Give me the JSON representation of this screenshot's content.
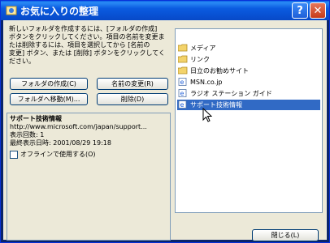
{
  "window": {
    "title": "お気に入りの整理",
    "help_label": "?",
    "close_label": "✕"
  },
  "instructions": [
    "新しいフォルダを作成するには、[フォルダの作成]",
    "ボタンをクリックしてください。項目の名前を変更ま",
    "たは削除するには、項目を選択してから [名前の",
    "変更] ボタン、または [削除] ボタンをクリックしてく",
    "ださい。"
  ],
  "buttons": {
    "create_folder": "フォルダの作成(C)",
    "rename": "名前の変更(R)",
    "move_to_folder": "フォルダへ移動(M)...",
    "delete": "削除(D)",
    "close": "閉じる(L)"
  },
  "details": {
    "name": "サポート技術情報",
    "url": "http://www.microsoft.com/japan/support...",
    "visit_count": "表示回数: 1",
    "last_visited": "最終表示日時: 2001/08/29 19:18",
    "offline_label": "オフラインで使用する(O)",
    "offline_checked": false
  },
  "favorites": [
    {
      "label": "メディア",
      "icon": "folder-icon",
      "selected": false
    },
    {
      "label": "リンク",
      "icon": "folder-icon",
      "selected": false
    },
    {
      "label": "日立のお勧めサイト",
      "icon": "folder-icon",
      "selected": false
    },
    {
      "label": "MSN.co.jp",
      "icon": "ie-page-icon",
      "selected": false
    },
    {
      "label": "ラジオ ステーション ガイド",
      "icon": "ie-page-icon",
      "selected": false
    },
    {
      "label": "サポート技術情報",
      "icon": "ie-page-icon",
      "selected": true
    }
  ],
  "colors": {
    "titlebar": "#0a5be0",
    "selection": "#316ac5",
    "face": "#ece9d8"
  }
}
